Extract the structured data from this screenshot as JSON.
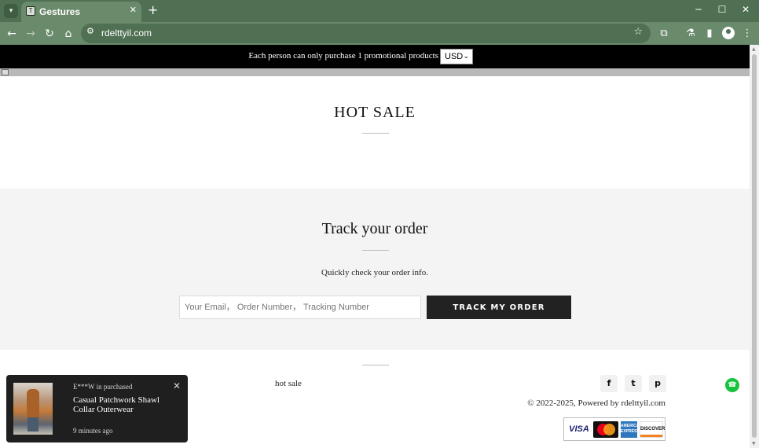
{
  "browser": {
    "tab_title": "Gestures",
    "tab_close": "✕",
    "new_tab": "+",
    "url": "rdelttyil.com"
  },
  "announcement": {
    "text": "Each person can only purchase 1 promotional products",
    "currency": "USD"
  },
  "hot_sale": {
    "title": "HOT SALE"
  },
  "track": {
    "title": "Track your order",
    "subtitle": "Quickly check your order info.",
    "input_placeholder": "Your Email， Order Number， Tracking Number",
    "button_label": "TRACK MY ORDER"
  },
  "footer": {
    "link": "hot sale",
    "social": [
      {
        "name": "facebook-icon",
        "glyph": "f"
      },
      {
        "name": "twitter-icon",
        "glyph": "t"
      },
      {
        "name": "pinterest-icon",
        "glyph": "p"
      }
    ],
    "copyright": "© 2022-2025, Powered by rdelttyil.com",
    "payments": {
      "visa": "VISA",
      "amex": "AMERICAN EXPRESS",
      "discover": "DISCOVER"
    }
  },
  "purchase_popup": {
    "buyer": "E***W in purchased",
    "product": "Casual Patchwork Shawl Collar Outerwear",
    "time": "9 minutes ago"
  },
  "colors": {
    "chrome": "#4f7052",
    "announcement_bg": "#000000",
    "track_bg": "#f4f4f4",
    "button_bg": "#222222",
    "chat": "#18c23e"
  }
}
